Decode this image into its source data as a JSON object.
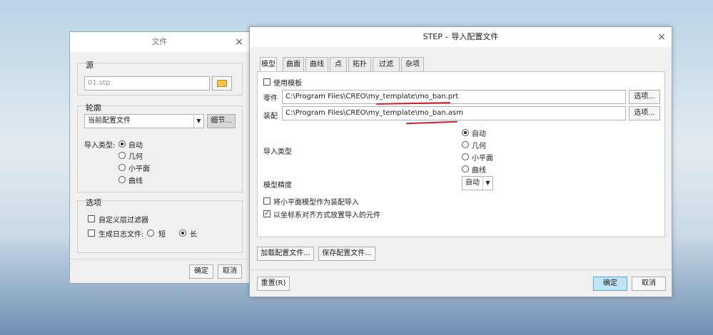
{
  "file_dialog": {
    "title": "文件",
    "source": {
      "label": "源",
      "value": "01.stp"
    },
    "profile": {
      "label": "轮廓",
      "selected": "当前配置文件",
      "detail_button": "细节...",
      "import_type_label": "导入类型:",
      "options": [
        "自动",
        "几何",
        "小平面",
        "曲线"
      ]
    },
    "options_group": {
      "label": "选项",
      "custom_layer_filter": "自定义层过滤器",
      "generate_log": "生成日志文件:",
      "short": "短",
      "long": "长"
    },
    "ok": "确定",
    "cancel": "取消"
  },
  "step_dialog": {
    "title": "STEP – 导入配置文件",
    "tabs": [
      "模型",
      "曲面",
      "曲线",
      "点",
      "拓扑",
      "过滤",
      "杂项"
    ],
    "use_template": "使用模板",
    "part_label": "零件",
    "part_path": "C:\\Program Files\\CREO\\my_template\\mo_ban.prt",
    "assembly_label": "装配",
    "assembly_path": "C:\\Program Files\\CREO\\my_template\\mo_ban.asm",
    "options_button": "选项...",
    "import_type_label": "导入类型",
    "import_options": [
      "自动",
      "几何",
      "小平面",
      "曲线"
    ],
    "model_precision_label": "模型精度",
    "model_precision_value": "自动",
    "facet_as_assembly": "将小平面模型作为装配导入",
    "align_csys": "以坐标系对齐方式放置导入的元件",
    "load_config": "加载配置文件...",
    "save_config": "保存配置文件...",
    "reset": "重置(R)",
    "ok": "确定",
    "cancel": "取消"
  },
  "colors": {
    "primary_button": "#bfe3f7",
    "annotation_red": "#c8202a"
  }
}
